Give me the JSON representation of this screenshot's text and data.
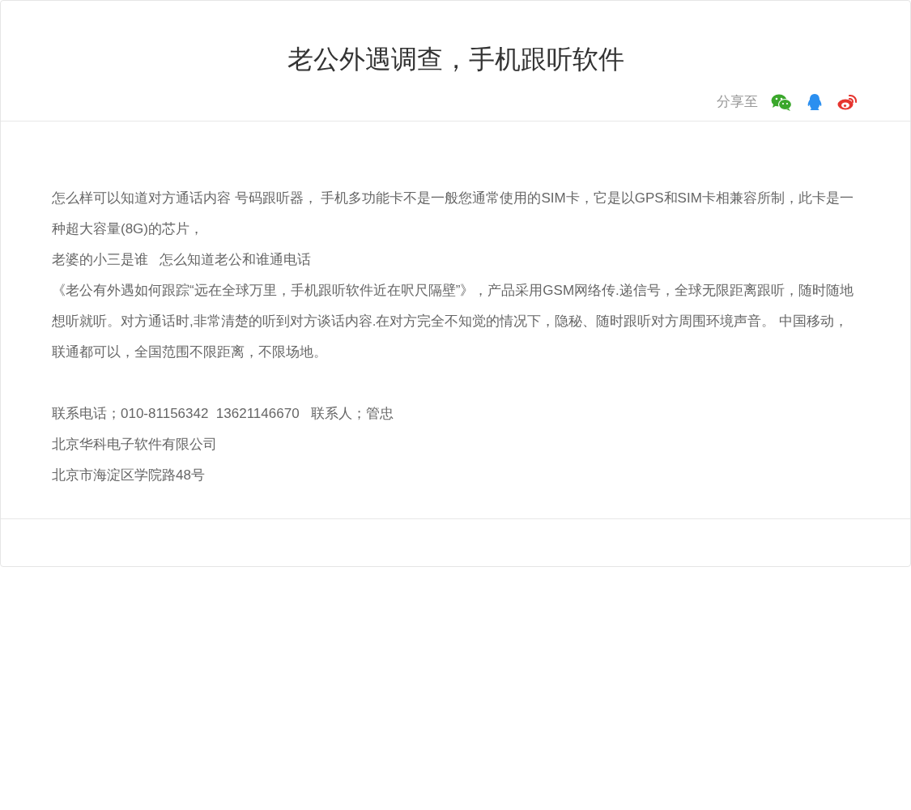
{
  "title": "老公外遇调查，手机跟听软件",
  "share": {
    "label": "分享至",
    "targets": [
      {
        "kind": "wechat"
      },
      {
        "kind": "qq"
      },
      {
        "kind": "weibo"
      }
    ]
  },
  "body": [
    {
      "kind": "paragraph",
      "text": "怎么样可以知道对方通话内容 号码跟听器， 手机多功能卡不是一般您通常使用的SIM卡，它是以GPS和SIM卡相兼容所制，此卡是一种超大容量(8G)的芯片，"
    },
    {
      "kind": "paragraph",
      "text": "老婆的小三是谁   怎么知道老公和谁通电话"
    },
    {
      "kind": "paragraph",
      "text": "《老公有外遇如何跟踪“远在全球万里，手机跟听软件近在呎尺隔壁”》，产品采用GSM网络传.递信号，全球无限距离跟听，随时随地想听就听。对方通话时,非常清楚的听到对方谈话内容.在对方完全不知觉的情况下，隐秘、随时跟听对方周围环境声音。 中国移动，联通都可以，全国范围不限距离，不限场地。"
    },
    {
      "kind": "blank"
    },
    {
      "kind": "paragraph",
      "text": "联系电话；010-81156342  13621146670   联系人；管忠"
    },
    {
      "kind": "paragraph",
      "text": "北京华科电子软件有限公司"
    },
    {
      "kind": "paragraph",
      "text": "北京市海淀区学院路48号"
    }
  ]
}
